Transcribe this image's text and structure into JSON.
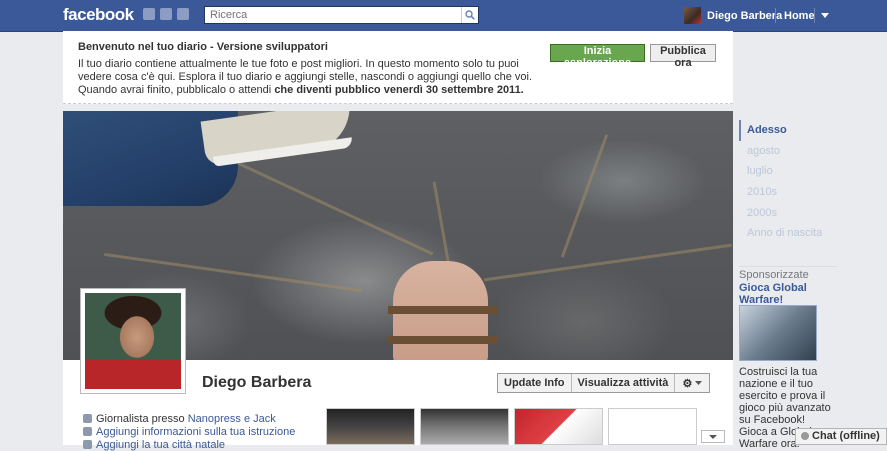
{
  "topbar": {
    "logo": "facebook",
    "search_placeholder": "Ricerca",
    "user_name": "Diego Barbera",
    "home": "Home"
  },
  "welcome": {
    "title": "Benvenuto nel tuo diario - Versione sviluppatori",
    "body": "Il tuo diario contiene attualmente le tue foto e post migliori. In questo momento solo tu puoi vedere cosa c'è qui. Esplora il tuo diario e aggiungi stelle, nascondi o aggiungi quello che voi. Quando avrai finito, pubblicalo o attendi ",
    "body_bold": "che diventi pubblico venerdì 30 settembre 2011.",
    "explore_button": "Inizia esplorazione",
    "publish_button": "Pubblica ora"
  },
  "profile": {
    "name": "Diego Barbera",
    "update_info": "Update Info",
    "activity": "Visualizza attività"
  },
  "info": {
    "job_prefix": "Giornalista presso ",
    "job_link": "Nanopress e Jack",
    "education": "Aggiungi informazioni sulla tua istruzione",
    "city": "Aggiungi la tua città natale"
  },
  "timeline": {
    "items": [
      "Adesso",
      "agosto",
      "luglio",
      "2010s",
      "2000s",
      "Anno di nascita"
    ]
  },
  "sponsored": {
    "header": "Sponsorizzate",
    "ad_title": "Gioca Global Warfare!",
    "ad_text": "Costruisci la tua nazione e il tuo esercito e prova il gioco più avanzato su Facebook! Gioca a Global Warfare ora!"
  },
  "chat": {
    "label": "Chat (offline)"
  },
  "colors": {
    "brand": "#3b5998",
    "green_button": "#69a74e"
  }
}
